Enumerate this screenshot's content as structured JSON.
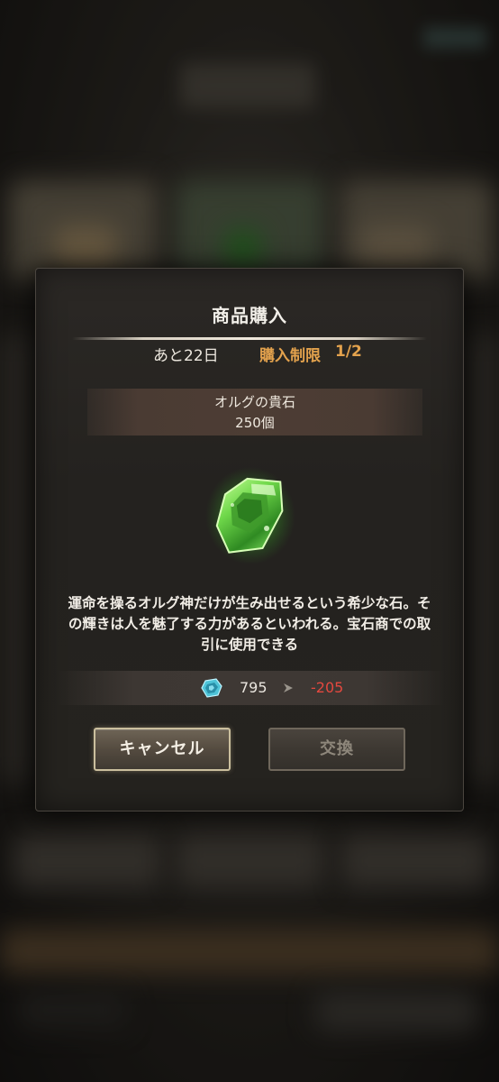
{
  "dialog": {
    "title": "商品購入",
    "days_left": "あと22日",
    "purchase_limit_label": "購入制限",
    "purchase_limit_value": "1/2",
    "item": {
      "name": "オルグの貴石",
      "quantity": "250個",
      "icon": "green-gem-icon"
    },
    "description_lines": [
      "運命を操るオルグ神だけが生み出せるという希少な石。そ",
      "の輝きは人を魅了する力があるといわれる。宝石商での取",
      "引に使用できる"
    ],
    "cost": {
      "currency_icon": "blue-gem-currency-icon",
      "owned": "795",
      "arrow_icon": "right-arrow-icon",
      "change": "-205"
    },
    "buttons": {
      "cancel": "キャンセル",
      "exchange": "交換"
    }
  },
  "colors": {
    "accent_orange": "#e3a24d",
    "negative_red": "#e4483f",
    "gem_green": "#5fd94a"
  }
}
